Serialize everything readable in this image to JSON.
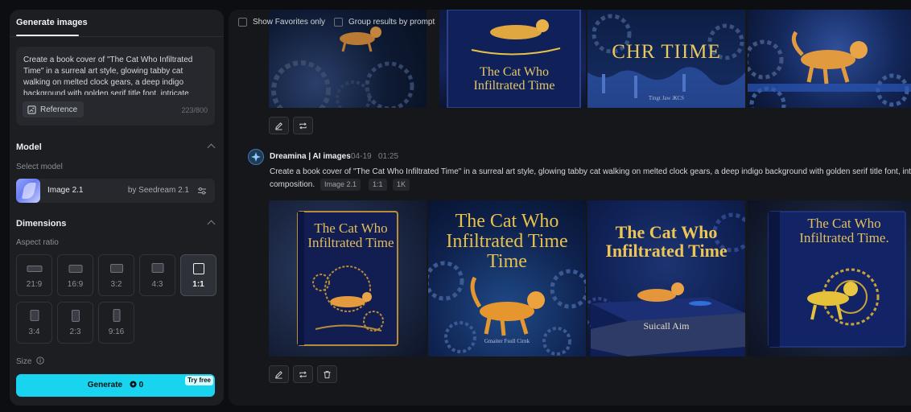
{
  "sidebar": {
    "tab_label": "Generate images",
    "prompt": {
      "text": "Create a book cover of \"The Cat Who Infiltrated Time\" in a surreal art style, glowing tabby cat walking on melted clock gears, a deep indigo background with golden serif title font, intricate details, cinematic composition.",
      "reference_label": "Reference",
      "char_count": "223/800"
    },
    "model_section": {
      "title": "Model",
      "select_label": "Select model",
      "model_name": "Image 2.1",
      "model_by": "by Seedream 2.1"
    },
    "dimensions_section": {
      "title": "Dimensions",
      "aspect_label": "Aspect ratio",
      "ratios": [
        {
          "label": "21:9",
          "selected": false
        },
        {
          "label": "16:9",
          "selected": false
        },
        {
          "label": "3:2",
          "selected": false
        },
        {
          "label": "4:3",
          "selected": false
        },
        {
          "label": "1:1",
          "selected": true
        },
        {
          "label": "3:4",
          "selected": false
        },
        {
          "label": "2:3",
          "selected": false
        },
        {
          "label": "9:16",
          "selected": false
        }
      ],
      "size_label": "Size"
    },
    "generate": {
      "label": "Generate",
      "cost": "0",
      "badge": "Try free"
    }
  },
  "results": {
    "filters": {
      "favorites_label": "Show Favorites only",
      "group_label": "Group results by prompt"
    },
    "top_group": {
      "images": [
        {
          "title_text": ""
        },
        {
          "title_text": "The Cat Who Infiltrated Time"
        },
        {
          "title_text": "CHR TIIME",
          "subtitle_text": "Tingt Jaw ЖCS"
        },
        {
          "title_text": ""
        }
      ]
    },
    "generation": {
      "source": "Dreamina | AI images",
      "date": "04-19",
      "time": "01:25",
      "prompt_line1": "Create a book cover of \"The Cat Who Infiltrated Time\" in a surreal art style, glowing tabby cat walking on melted clock gears, a deep indigo background with golden serif title font, intricate details, cinematic",
      "prompt_line2": "composition.",
      "tags": [
        "Image 2.1",
        "1:1",
        "1K"
      ],
      "images": [
        {
          "title_text": "The Cat Who Infiltrated Time"
        },
        {
          "title_text": "The Cat Who Infiltrated Time Time",
          "footer_text": "Gmaiter Fsull Cirnk"
        },
        {
          "title_text": "The Cat Who Infiltrated Time",
          "footer_text": "Suicall Aim"
        },
        {
          "title_text": "The Cat Who Infiltrated Time."
        }
      ]
    }
  },
  "colors": {
    "accent": "#19d4ef",
    "panel": "#1c1e22",
    "background": "#0d0e11",
    "gold": "#e8c14a",
    "indigo": "#1a2a6a"
  }
}
